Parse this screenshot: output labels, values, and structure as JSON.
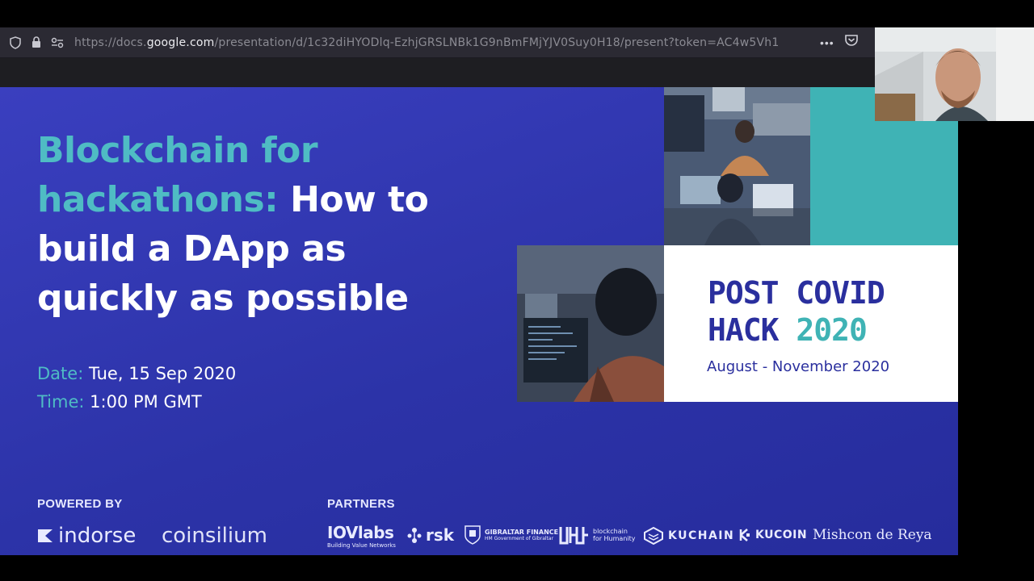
{
  "browser": {
    "url_prefix": "https://docs.",
    "url_host": "google.com",
    "url_path": "/presentation/d/1c32diHYODlq-EzhjGRSLNBk1G9nBmFMjYJV0Suy0H18/present?token=AC4w5Vh1",
    "more_label": "•••"
  },
  "slide": {
    "title_part1": "Blockchain for hackathons:",
    "title_part2": "How to build a DApp as quickly as possible",
    "date_key": "Date:",
    "date_value": "Tue, 15 Sep 2020",
    "time_key": "Time:",
    "time_value": "1:00 PM GMT",
    "hack_line1": "POST COVID",
    "hack_line2a": "HACK ",
    "hack_line2b": "2020",
    "hack_dates": "August - November 2020",
    "powered_by": "POWERED BY",
    "partners": "PARTNERS",
    "powered_logos": [
      "indorse",
      "coinsilium"
    ],
    "partner_logos": {
      "iov": "IOVlabs",
      "iov_sub": "Building Value Networks",
      "rsk": "rsk",
      "gib": "GIBRALTAR FINANCE",
      "gib_sub": "HM Government of Gibraltar",
      "bfh": "blockchain for Humanity",
      "kuchain": "KUCHAIN",
      "kucoin": "KUCOIN",
      "mishcon": "Mishcon de Reya"
    }
  },
  "colors": {
    "slide_bg": "#2c33a8",
    "teal": "#4fbcc4",
    "navy_text": "#2a2f9e"
  }
}
